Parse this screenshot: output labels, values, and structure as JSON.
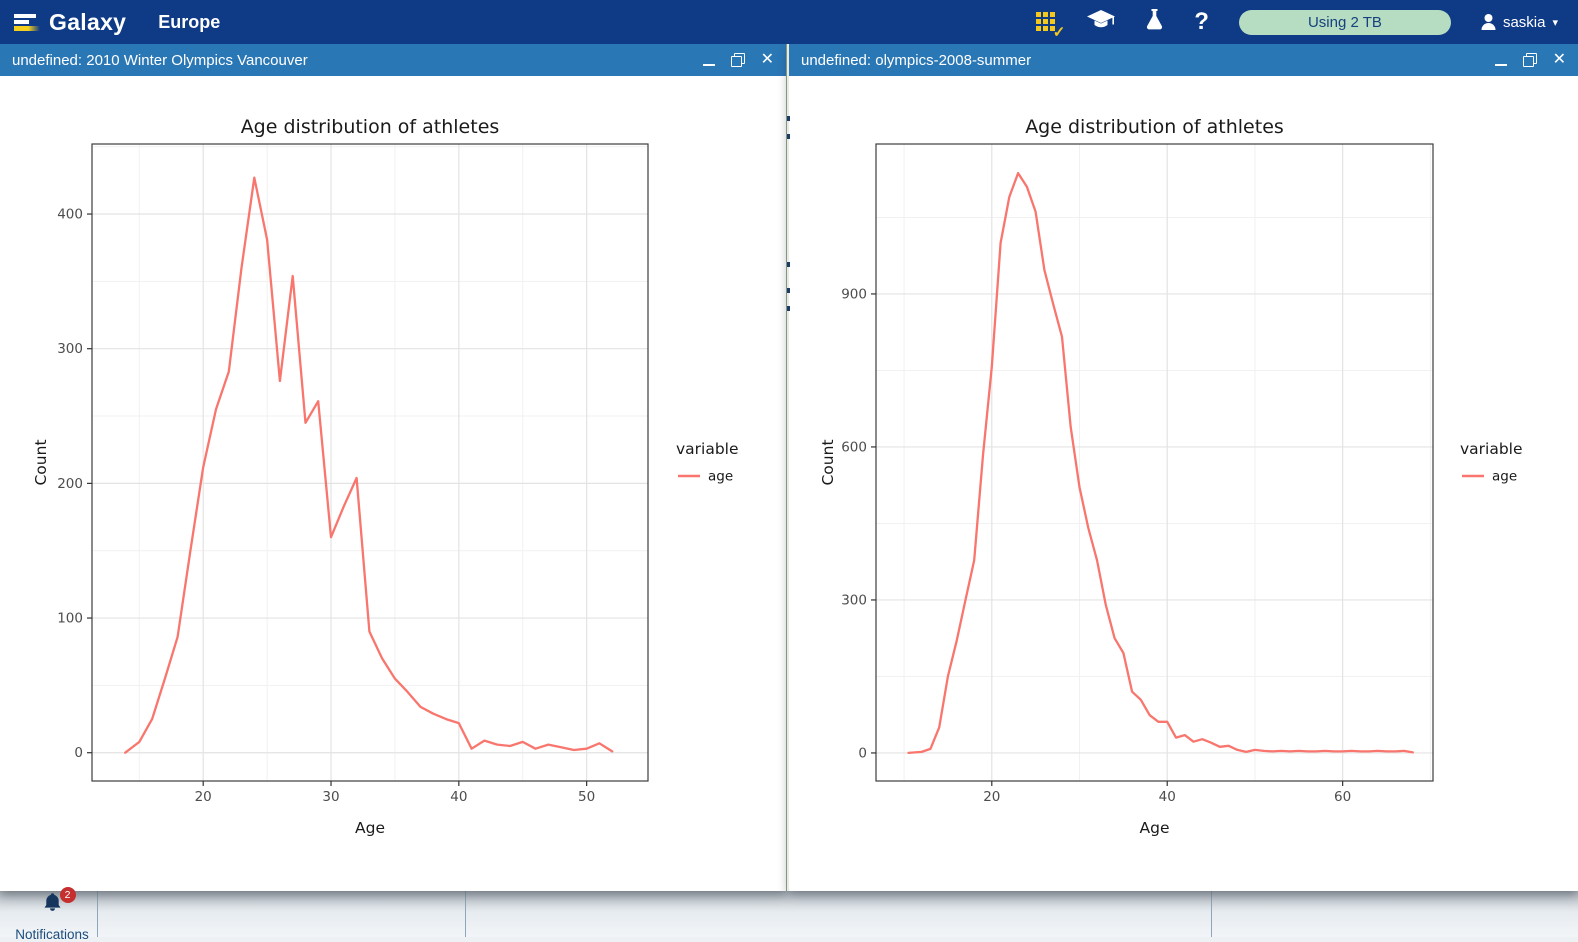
{
  "masthead": {
    "brand": "Galaxy",
    "subbrand": "Europe",
    "storage_label": "Using 2 TB",
    "user_name": "saskia",
    "glyphs": {
      "check": "✓",
      "help": "?",
      "caret": "▾"
    }
  },
  "windows": [
    {
      "title": "undefined: 2010 Winter Olympics Vancouver",
      "controls": {
        "close": "✕"
      }
    },
    {
      "title": "undefined: olympics-2008-summer",
      "controls": {
        "close": "✕"
      }
    }
  ],
  "notifications": {
    "label": "Notifications",
    "badge_count": "2"
  },
  "colors": {
    "masthead_bg": "#0e3a86",
    "titlebar_bg": "#2a77b6",
    "storage_pill_bg": "#b6ddc1",
    "line_color": "#f8766d",
    "badge_red": "#c52f2f"
  },
  "chart_data": [
    {
      "type": "line",
      "title": "Age distribution of athletes",
      "xlabel": "Age",
      "ylabel": "Count",
      "legend_title": "variable",
      "legend_position": "right",
      "grid": true,
      "xlim": [
        11.3,
        54.8
      ],
      "ylim": [
        -21,
        452
      ],
      "xticks": [
        20,
        30,
        40,
        50
      ],
      "xminor": [
        15,
        25,
        35,
        45
      ],
      "yticks": [
        0,
        100,
        200,
        300,
        400
      ],
      "yminor": [
        50,
        150,
        250,
        350,
        450
      ],
      "series": [
        {
          "name": "age",
          "color": "#f8766d",
          "x": [
            13.9,
            15,
            16,
            17,
            18,
            19,
            20,
            21,
            22,
            23,
            24,
            25,
            26,
            27,
            28,
            29,
            30,
            31,
            32,
            33,
            34,
            35,
            36,
            37,
            38,
            39,
            40,
            41,
            42,
            43,
            44,
            45,
            46,
            47,
            48,
            49,
            50,
            51,
            52
          ],
          "y": [
            0,
            8,
            25,
            55,
            86,
            150,
            212,
            255,
            283,
            360,
            427,
            381,
            276,
            354,
            245,
            261,
            160,
            183,
            204,
            90,
            70,
            55,
            45,
            34,
            29,
            25,
            22,
            3,
            9,
            6,
            5,
            8,
            3,
            6,
            4,
            2,
            3,
            7,
            1
          ]
        }
      ]
    },
    {
      "type": "line",
      "title": "Age distribution of athletes",
      "xlabel": "Age",
      "ylabel": "Count",
      "legend_title": "variable",
      "legend_position": "right",
      "grid": true,
      "xlim": [
        6.8,
        70.3
      ],
      "ylim": [
        -55,
        1194
      ],
      "xticks": [
        20,
        40,
        60
      ],
      "xminor": [
        10,
        30,
        50,
        70
      ],
      "yticks": [
        0,
        300,
        600,
        900
      ],
      "yminor": [
        150,
        450,
        750,
        1050
      ],
      "series": [
        {
          "name": "age",
          "color": "#f8766d",
          "x": [
            10.5,
            12,
            13,
            14,
            15,
            16,
            17,
            18,
            19,
            20,
            21,
            22,
            23,
            24,
            25,
            26,
            27,
            28,
            29,
            30,
            31,
            32,
            33,
            34,
            35,
            36,
            37,
            38,
            39,
            40,
            41,
            42,
            43,
            44,
            45,
            46,
            47,
            48,
            49,
            50,
            51,
            52,
            53,
            54,
            55,
            56,
            57,
            58,
            59,
            60,
            61,
            62,
            63,
            64,
            65,
            66,
            67,
            68
          ],
          "y": [
            0,
            2,
            8,
            50,
            150,
            220,
            300,
            378,
            584,
            757,
            1000,
            1090,
            1137,
            1110,
            1061,
            947,
            880,
            816,
            639,
            521,
            441,
            378,
            290,
            225,
            196,
            120,
            104,
            74,
            61,
            61,
            30,
            35,
            22,
            27,
            20,
            12,
            14,
            6,
            2,
            6,
            4,
            3,
            4,
            3,
            4,
            3,
            3,
            4,
            3,
            3,
            4,
            3,
            3,
            4,
            3,
            3,
            4,
            1
          ]
        }
      ]
    }
  ]
}
